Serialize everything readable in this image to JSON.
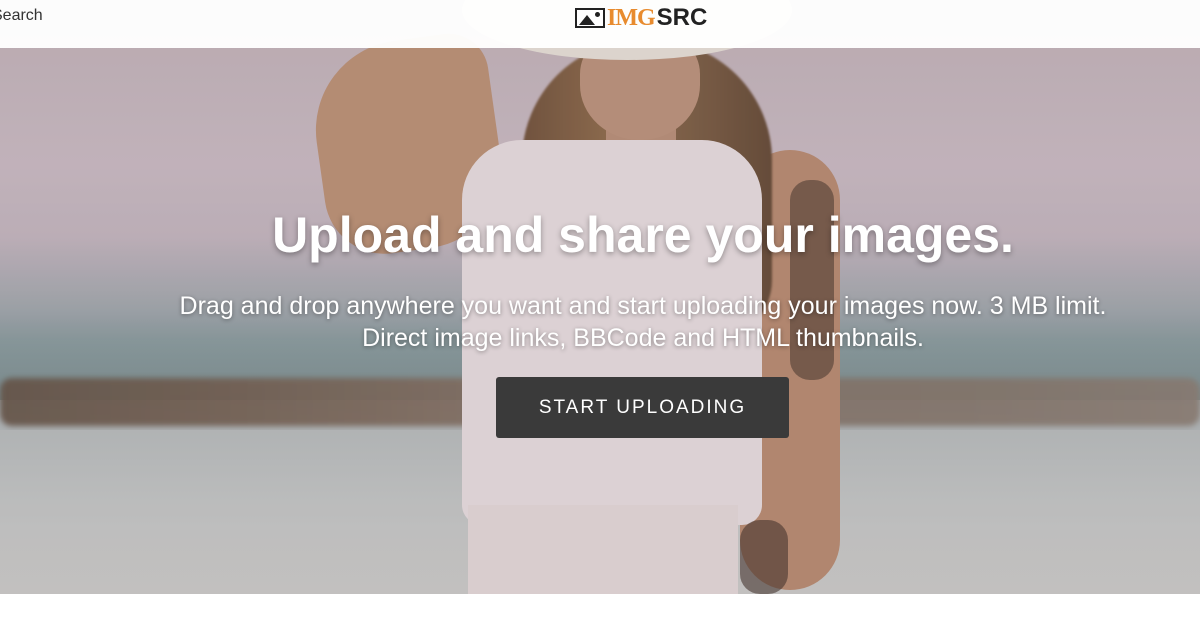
{
  "header": {
    "search_label": "Search",
    "logo": {
      "img_text": "IMG",
      "src_text": "SRC",
      "icon": "image-icon",
      "accent_color": "#e88b2e"
    }
  },
  "hero": {
    "headline": "Upload and share your images.",
    "subtext": "Drag and drop anywhere you want and start uploading your images now. 3 MB limit. Direct image links, BBCode and HTML thumbnails.",
    "cta_label": "START UPLOADING",
    "cta_color": "#3a3a3a"
  }
}
